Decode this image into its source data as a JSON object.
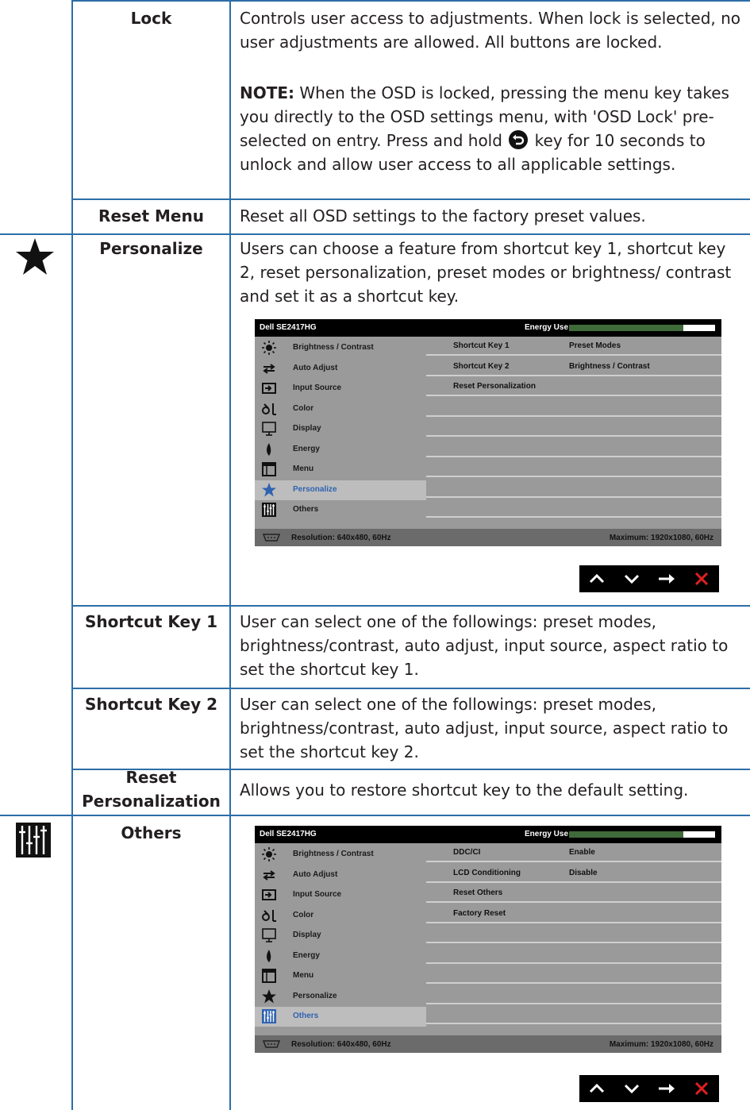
{
  "rows": {
    "lock": {
      "label": "Lock",
      "desc": "Controls user access to adjustments. When lock is selected, no user adjustments are allowed. All buttons are locked.",
      "note_prefix": "NOTE:",
      "note_a": "When the OSD is locked, pressing the menu key takes you directly to the OSD settings menu, with 'OSD Lock' pre-selected on entry. Press and hold",
      "note_b": "key for 10 seconds to unlock and allow user access to all applicable settings."
    },
    "reset_menu": {
      "label": "Reset Menu",
      "desc": "Reset all OSD settings to the factory preset values."
    },
    "personalize": {
      "label": "Personalize",
      "desc": "Users can choose a feature from shortcut key 1, shortcut key 2, reset personalization, preset modes or brightness/ contrast and set it as a shortcut key."
    },
    "shortcut1": {
      "label": "Shortcut Key 1",
      "desc": "User can select one of the followings: preset modes, brightness/contrast, auto adjust, input source, aspect ratio to set the shortcut key 1."
    },
    "shortcut2": {
      "label": "Shortcut Key 2",
      "desc": "User can select one of the followings: preset modes, brightness/contrast, auto adjust, input source, aspect ratio to set the shortcut key 2."
    },
    "reset_personalization": {
      "label_1": "Reset",
      "label_2": "Personalization",
      "desc": "Allows you to restore shortcut key to the default setting."
    },
    "others": {
      "label": "Others"
    }
  },
  "osd": {
    "title": "Dell SE2417HG",
    "energy_label": "Energy Use",
    "energy_level": 0.78,
    "menu": [
      "Brightness / Contrast",
      "Auto Adjust",
      "Input Source",
      "Color",
      "Display",
      "Energy",
      "Menu",
      "Personalize",
      "Others"
    ],
    "resolution": "Resolution: 640x480, 60Hz",
    "maximum": "Maximum: 1920x1080, 60Hz"
  },
  "osd1": {
    "selected": "Personalize",
    "rows": [
      {
        "name": "Shortcut Key 1",
        "value": "Preset Modes"
      },
      {
        "name": "Shortcut Key 2",
        "value": "Brightness / Contrast"
      },
      {
        "name": "Reset Personalization",
        "value": ""
      }
    ]
  },
  "osd2": {
    "selected": "Others",
    "rows": [
      {
        "name": "DDC/CI",
        "value": "Enable"
      },
      {
        "name": "LCD Conditioning",
        "value": "Disable"
      },
      {
        "name": "Reset Others",
        "value": ""
      },
      {
        "name": "Factory Reset",
        "value": ""
      }
    ]
  },
  "keys": [
    "up-icon",
    "down-icon",
    "enter-icon",
    "exit-icon"
  ],
  "colors": {
    "rule": "#2c6ea8",
    "accent": "#2f63b0",
    "exit": "#e02020"
  }
}
